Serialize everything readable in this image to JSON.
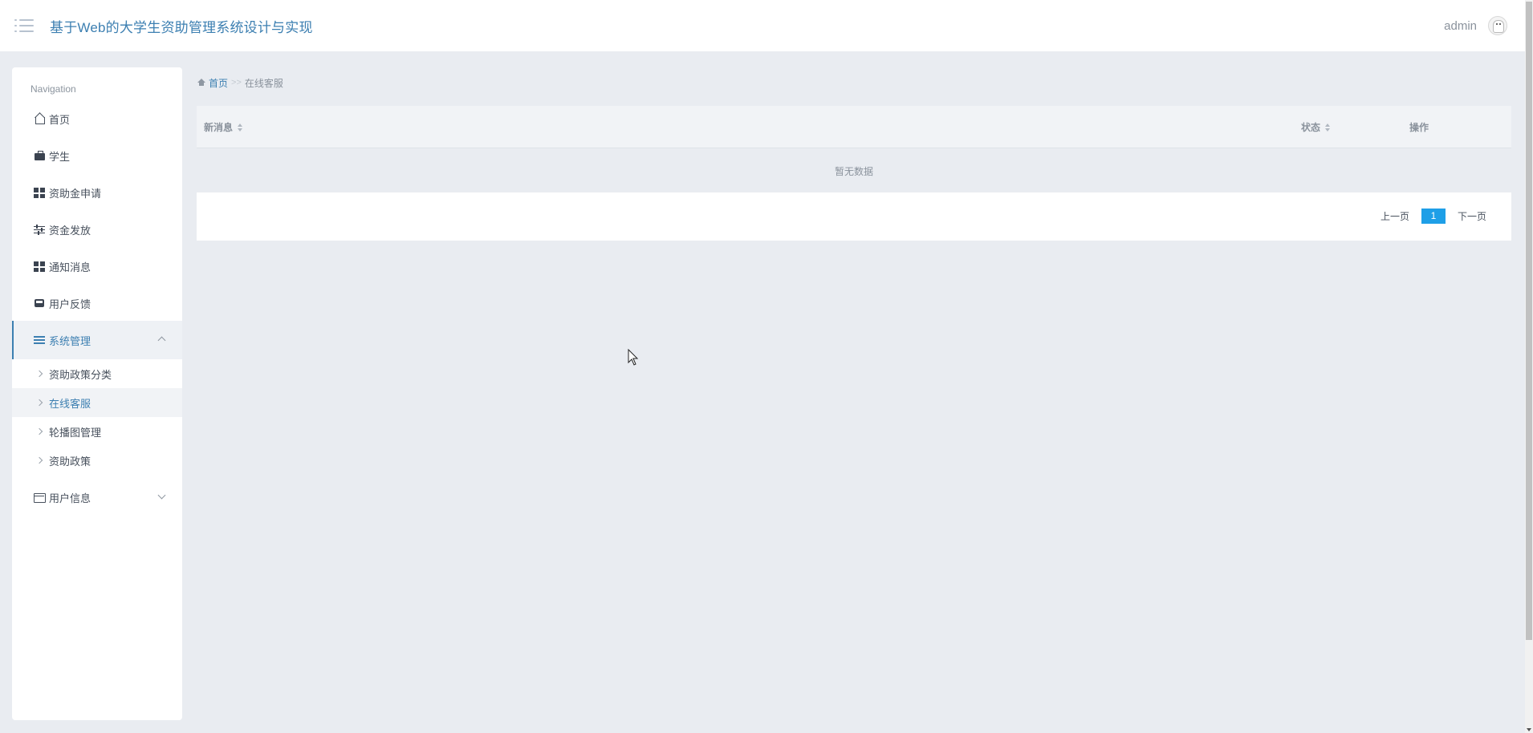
{
  "header": {
    "app_title": "基于Web的大学生资助管理系统设计与实现",
    "user_name": "admin"
  },
  "sidebar": {
    "nav_title": "Navigation",
    "items": [
      {
        "label": "首页",
        "icon": "home-icon"
      },
      {
        "label": "学生",
        "icon": "briefcase-icon"
      },
      {
        "label": "资助金申请",
        "icon": "grid-icon"
      },
      {
        "label": "资金发放",
        "icon": "sliders-icon"
      },
      {
        "label": "通知消息",
        "icon": "grid-icon"
      },
      {
        "label": "用户反馈",
        "icon": "inbox-icon"
      },
      {
        "label": "系统管理",
        "icon": "list-icon",
        "expanded": true,
        "active": true
      },
      {
        "label": "用户信息",
        "icon": "card-icon",
        "expanded": false
      }
    ],
    "system_sub_items": [
      {
        "label": "资助政策分类"
      },
      {
        "label": "在线客服",
        "active": true
      },
      {
        "label": "轮播图管理"
      },
      {
        "label": "资助政策"
      }
    ]
  },
  "breadcrumb": {
    "home": "首页",
    "separator": ">>",
    "current": "在线客服"
  },
  "table": {
    "columns": [
      "新消息",
      "状态",
      "操作"
    ],
    "empty_text": "暂无数据"
  },
  "pagination": {
    "prev": "上一页",
    "current_page": "1",
    "next": "下一页"
  },
  "colors": {
    "accent": "#3c7fb1",
    "page_active": "#1e9fe7",
    "background": "#e9ecf1"
  }
}
